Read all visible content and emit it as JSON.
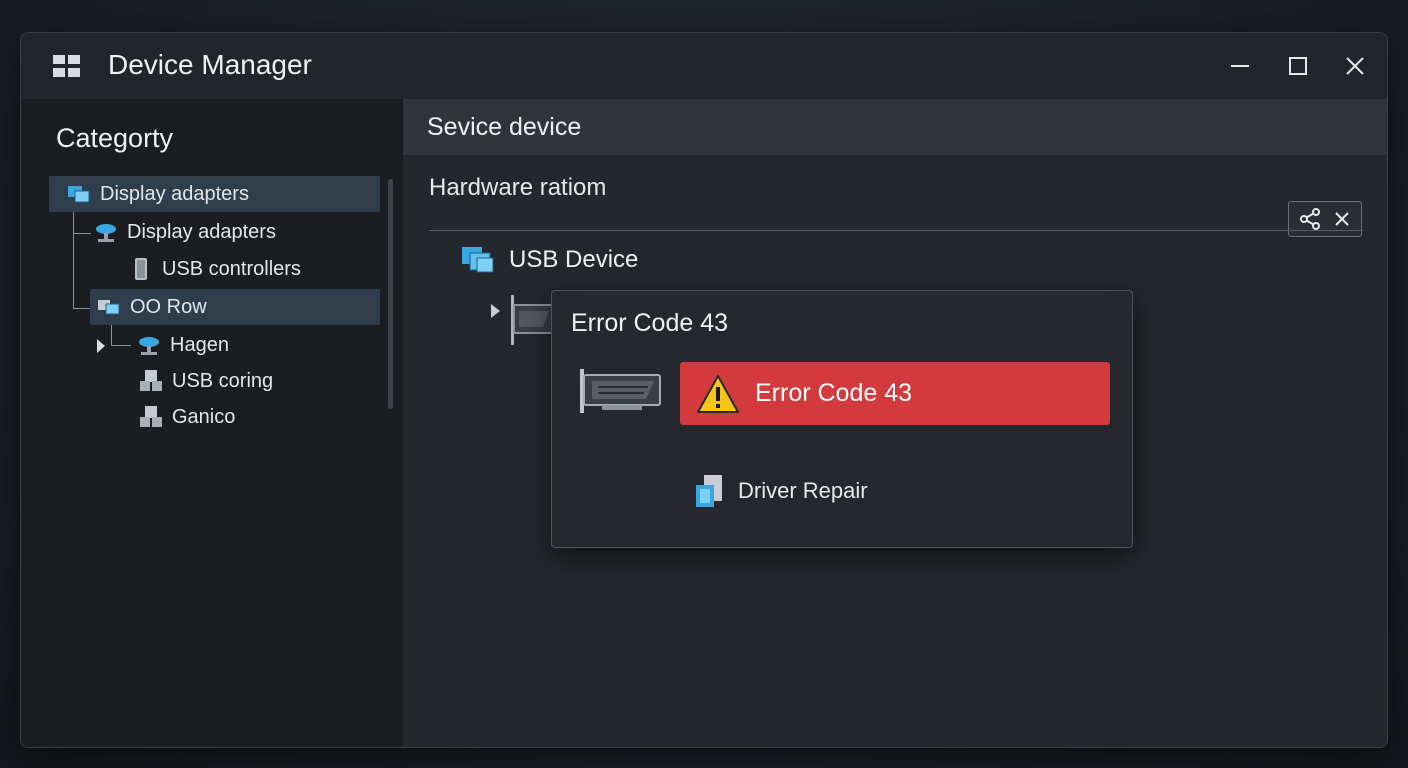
{
  "window": {
    "title": "Device Manager",
    "controls": {
      "minimize": "minimize-icon",
      "maximize": "maximize-icon",
      "close": "close-icon"
    }
  },
  "sidebar": {
    "heading": "Categorty",
    "items": [
      {
        "label": "Display adapters",
        "icon": "display-adapter-icon",
        "selected": true
      },
      {
        "label": "Display adapters",
        "icon": "network-icon",
        "selected": false
      },
      {
        "label": "USB controllers",
        "icon": "usb-stick-icon",
        "selected": false
      },
      {
        "label": "OO Row",
        "icon": "display-adapter-icon",
        "selected": true
      },
      {
        "label": "Hagen",
        "icon": "network-icon",
        "selected": false
      },
      {
        "label": "USB coring",
        "icon": "usb-hub-icon",
        "selected": false
      },
      {
        "label": "Ganico",
        "icon": "usb-hub-icon",
        "selected": false
      }
    ]
  },
  "main": {
    "header_title": "Sevice device",
    "section_title": "Hardware ratiom",
    "device": {
      "label": "USB Device",
      "icon": "usb-device-icon"
    }
  },
  "popup": {
    "title": "Error Code 43",
    "error_label": "Error Code 43",
    "repair_label": "Driver Repair",
    "colors": {
      "error_background": "#d23a3d",
      "warning_icon": "#f5c518"
    }
  },
  "colors": {
    "background": "#1b1f25",
    "selected_row": "#2f3d4d",
    "accent_blue": "#3aa8e0"
  }
}
